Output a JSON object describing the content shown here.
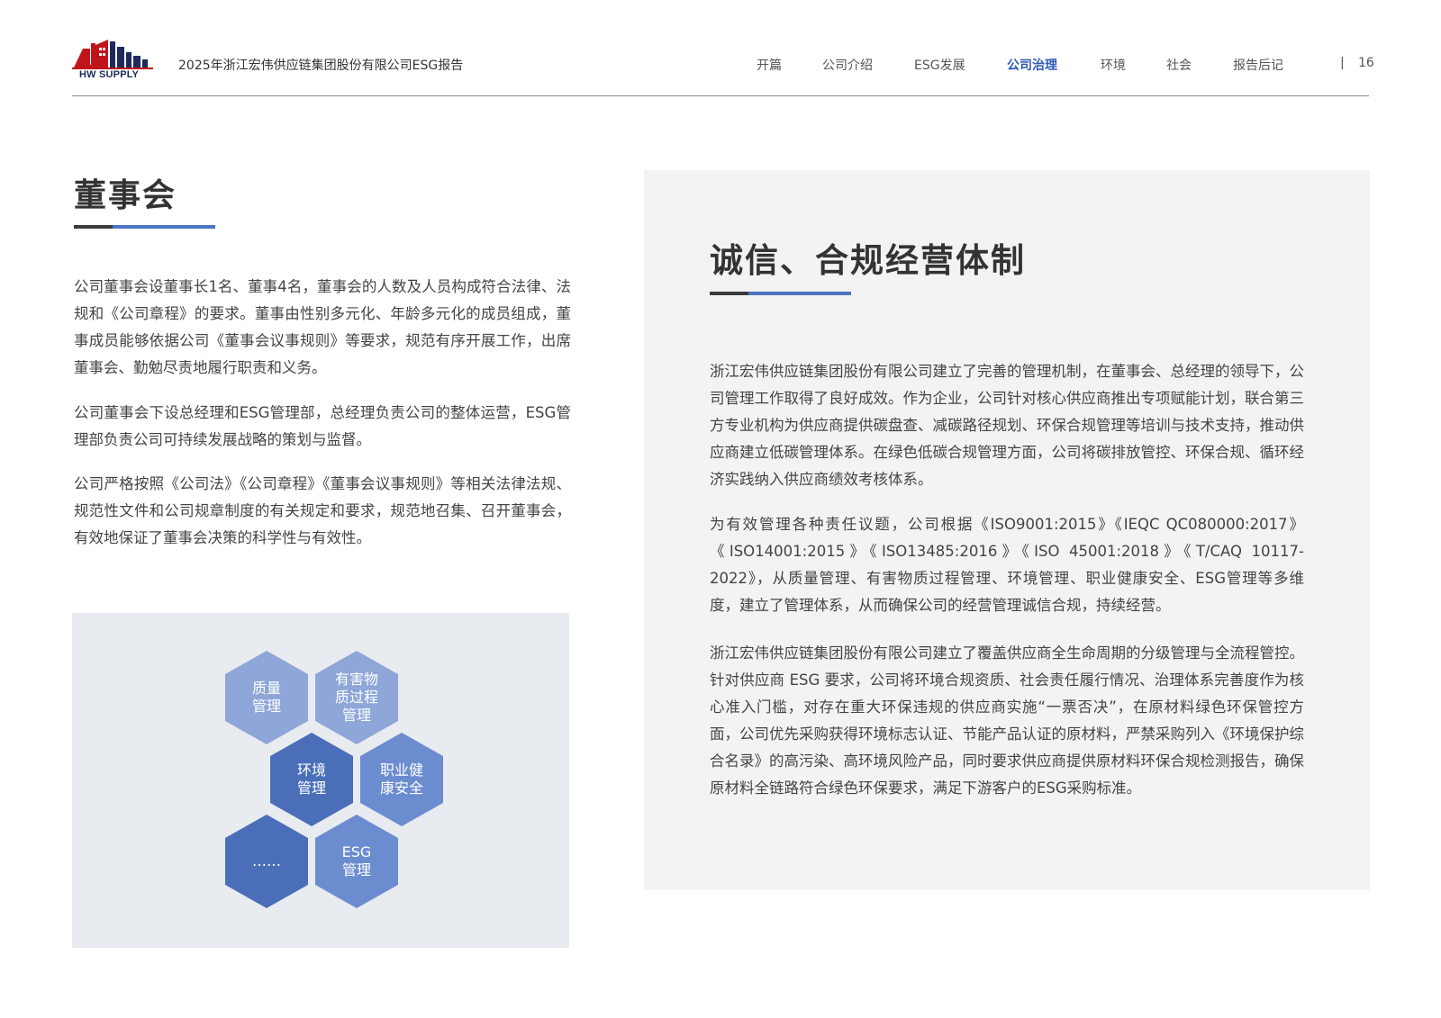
{
  "header": {
    "logo_text": "HW SUPPLY",
    "report_title": "2025年浙江宏伟供应链集团股份有限公司ESG报告",
    "nav": [
      {
        "label": "开篇",
        "active": false
      },
      {
        "label": "公司介绍",
        "active": false
      },
      {
        "label": "ESG发展",
        "active": false
      },
      {
        "label": "公司治理",
        "active": true
      },
      {
        "label": "环境",
        "active": false
      },
      {
        "label": "社会",
        "active": false
      },
      {
        "label": "报告后记",
        "active": false
      }
    ],
    "separator": "|",
    "page_number": "16"
  },
  "left": {
    "title": "董事会",
    "paragraphs": [
      "公司董事会设董事长1名、董事4名，董事会的人数及人员构成符合法律、法规和《公司章程》的要求。董事由性别多元化、年龄多元化的成员组成，董事成员能够依据公司《董事会议事规则》等要求，规范有序开展工作，出席董事会、勤勉尽责地履行职责和义务。",
      "公司董事会下设总经理和ESG管理部，总经理负责公司的整体运营，ESG管理部负责公司可持续发展战略的策划与监督。",
      "公司严格按照《公司法》《公司章程》《董事会议事规则》等相关法律法规、规范性文件和公司规章制度的有关规定和要求，规范地召集、召开董事会，有效地保证了董事会决策的科学性与有效性。"
    ],
    "hexagons": [
      {
        "label": "质量\n管理",
        "color": "#8ea6d8"
      },
      {
        "label": "有害物\n质过程\n管理",
        "color": "#8ea6d8"
      },
      {
        "label": "环境\n管理",
        "color": "#4a6fb8"
      },
      {
        "label": "职业健\n康安全",
        "color": "#6c8cd0"
      },
      {
        "label": "……",
        "color": "#4a6fb8"
      },
      {
        "label": "ESG\n管理",
        "color": "#6c8cd0"
      }
    ]
  },
  "right": {
    "title": "诚信、合规经营体制",
    "paragraphs": [
      "浙江宏伟供应链集团股份有限公司建立了完善的管理机制，在董事会、总经理的领导下，公司管理工作取得了良好成效。作为企业，公司针对核心供应商推出专项赋能计划，联合第三方专业机构为供应商提供碳盘查、减碳路径规划、环保合规管理等培训与技术支持，推动供应商建立低碳管理体系。在绿色低碳合规管理方面，公司将碳排放管控、环保合规、循环经济实践纳入供应商绩效考核体系。",
      "为有效管理各种责任议题，公司根据《ISO9001:2015》《IEQC QC080000:2017》《ISO14001:2015》《ISO13485:2016》《ISO 45001:2018》《T/CAQ 10117-2022》，从质量管理、有害物质过程管理、环境管理、职业健康安全、ESG管理等多维度，建立了管理体系，从而确保公司的经营管理诚信合规，持续经营。",
      "浙江宏伟供应链集团股份有限公司建立了覆盖供应商全生命周期的分级管理与全流程管控。针对供应商 ESG 要求，公司将环境合规资质、社会责任履行情况、治理体系完善度作为核心准入门槛，对存在重大环保违规的供应商实施“一票否决”，在原材料绿色环保管控方面，公司优先采购获得环境标志认证、节能产品认证的原材料，严禁采购列入《环境保护综合名录》的高污染、高环境风险产品，同时要求供应商提供原材料环保合规检测报告，确保原材料全链路符合绿色环保要求，满足下游客户的ESG采购标准。"
    ]
  }
}
